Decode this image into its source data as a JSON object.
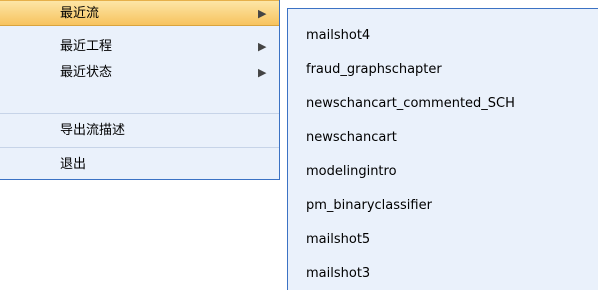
{
  "menu": {
    "items": [
      {
        "label": "最近流",
        "has_submenu": true,
        "highlighted": true
      },
      {
        "label": "最近工程",
        "has_submenu": true
      },
      {
        "label": "最近状态",
        "has_submenu": true
      },
      {
        "label": "导出流描述"
      },
      {
        "label": "退出"
      }
    ],
    "arrow_glyph": "▶"
  },
  "submenu": {
    "items": [
      {
        "label": "mailshot4"
      },
      {
        "label": "fraud_graphschapter"
      },
      {
        "label": "newschancart_commented_SCH"
      },
      {
        "label": "newschancart"
      },
      {
        "label": "modelingintro"
      },
      {
        "label": "pm_binaryclassifier"
      },
      {
        "label": "mailshot5"
      },
      {
        "label": "mailshot3"
      }
    ]
  },
  "colors": {
    "menu_background": "#eaf1fb",
    "highlight_top": "#fde6a6",
    "highlight_bottom": "#f7c35e",
    "border": "#3b72c4"
  }
}
